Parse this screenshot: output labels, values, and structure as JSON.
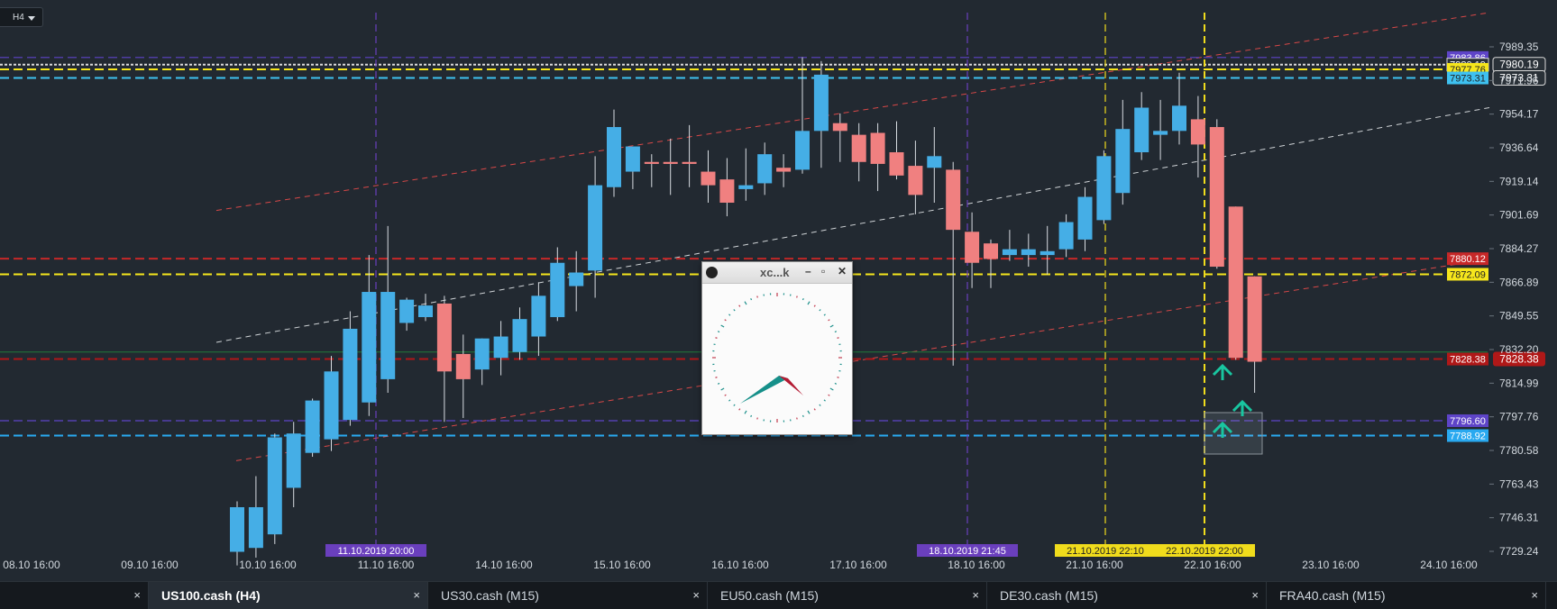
{
  "timeframe_select": {
    "value": "H4"
  },
  "chart_data": {
    "type": "candlestick",
    "symbol": "US100.cash",
    "timeframe": "H4",
    "ylim": [
      7722,
      7995
    ],
    "price_ticks": [
      "7989.35",
      "7971.96",
      "7954.17",
      "7936.64",
      "7919.14",
      "7901.69",
      "7884.27",
      "7866.89",
      "7849.55",
      "7832.20",
      "7814.99",
      "7797.76",
      "7780.58",
      "7763.43",
      "7746.31",
      "7729.24"
    ],
    "x_labels": [
      "08.10 16:00",
      "09.10 16:00",
      "10.10 16:00",
      "11.10 16:00",
      "14.10 16:00",
      "15.10 16:00",
      "16.10 16:00",
      "17.10 16:00",
      "18.10 16:00",
      "21.10 16:00",
      "22.10 16:00",
      "23.10 16:00",
      "24.10 16:00"
    ],
    "candles": [
      {
        "o": 7729,
        "h": 7755,
        "l": 7722,
        "c": 7752
      },
      {
        "o": 7731,
        "h": 7768,
        "l": 7726,
        "c": 7752
      },
      {
        "o": 7738,
        "h": 7790,
        "l": 7733,
        "c": 7788
      },
      {
        "o": 7762,
        "h": 7796,
        "l": 7752,
        "c": 7790
      },
      {
        "o": 7780,
        "h": 7808,
        "l": 7778,
        "c": 7807
      },
      {
        "o": 7787,
        "h": 7830,
        "l": 7781,
        "c": 7822
      },
      {
        "o": 7797,
        "h": 7853,
        "l": 7794,
        "c": 7844
      },
      {
        "o": 7806,
        "h": 7882,
        "l": 7799,
        "c": 7863
      },
      {
        "o": 7818,
        "h": 7897,
        "l": 7811,
        "c": 7863
      },
      {
        "o": 7847,
        "h": 7860,
        "l": 7843,
        "c": 7859
      },
      {
        "o": 7850,
        "h": 7862,
        "l": 7848,
        "c": 7856
      },
      {
        "o": 7857,
        "h": 7861,
        "l": 7796,
        "c": 7822
      },
      {
        "o": 7831,
        "h": 7841,
        "l": 7798,
        "c": 7818
      },
      {
        "o": 7823,
        "h": 7839,
        "l": 7815,
        "c": 7839
      },
      {
        "o": 7829,
        "h": 7848,
        "l": 7820,
        "c": 7840
      },
      {
        "o": 7832,
        "h": 7855,
        "l": 7828,
        "c": 7849
      },
      {
        "o": 7840,
        "h": 7868,
        "l": 7830,
        "c": 7861
      },
      {
        "o": 7850,
        "h": 7886,
        "l": 7848,
        "c": 7878
      },
      {
        "o": 7866,
        "h": 7884,
        "l": 7853,
        "c": 7873
      },
      {
        "o": 7874,
        "h": 7933,
        "l": 7860,
        "c": 7918
      },
      {
        "o": 7917,
        "h": 7957,
        "l": 7912,
        "c": 7948
      },
      {
        "o": 7925,
        "h": 7937,
        "l": 7916,
        "c": 7938
      },
      {
        "o": 7930,
        "h": 7934,
        "l": 7917,
        "c": 7929
      },
      {
        "o": 7930,
        "h": 7942,
        "l": 7913,
        "c": 7929
      },
      {
        "o": 7930,
        "h": 7949,
        "l": 7917,
        "c": 7929
      },
      {
        "o": 7925,
        "h": 7936,
        "l": 7909,
        "c": 7918
      },
      {
        "o": 7921,
        "h": 7932,
        "l": 7902,
        "c": 7909
      },
      {
        "o": 7916,
        "h": 7937,
        "l": 7910,
        "c": 7918
      },
      {
        "o": 7919,
        "h": 7940,
        "l": 7913,
        "c": 7934
      },
      {
        "o": 7927,
        "h": 7934,
        "l": 7917,
        "c": 7925
      },
      {
        "o": 7926,
        "h": 7984,
        "l": 7924,
        "c": 7946
      },
      {
        "o": 7946,
        "h": 7982,
        "l": 7927,
        "c": 7975
      },
      {
        "o": 7950,
        "h": 7955,
        "l": 7930,
        "c": 7946
      },
      {
        "o": 7944,
        "h": 7950,
        "l": 7920,
        "c": 7930
      },
      {
        "o": 7945,
        "h": 7950,
        "l": 7915,
        "c": 7929
      },
      {
        "o": 7935,
        "h": 7951,
        "l": 7921,
        "c": 7923
      },
      {
        "o": 7928,
        "h": 7941,
        "l": 7903,
        "c": 7913
      },
      {
        "o": 7927,
        "h": 7948,
        "l": 7909,
        "c": 7933
      },
      {
        "o": 7926,
        "h": 7930,
        "l": 7825,
        "c": 7895
      },
      {
        "o": 7894,
        "h": 7904,
        "l": 7865,
        "c": 7878
      },
      {
        "o": 7888,
        "h": 7890,
        "l": 7865,
        "c": 7880
      },
      {
        "o": 7882,
        "h": 7895,
        "l": 7879,
        "c": 7885
      },
      {
        "o": 7882,
        "h": 7893,
        "l": 7876,
        "c": 7885
      },
      {
        "o": 7882,
        "h": 7897,
        "l": 7872,
        "c": 7884
      },
      {
        "o": 7885,
        "h": 7903,
        "l": 7881,
        "c": 7899
      },
      {
        "o": 7890,
        "h": 7917,
        "l": 7884,
        "c": 7912
      },
      {
        "o": 7900,
        "h": 7936,
        "l": 7898,
        "c": 7933
      },
      {
        "o": 7914,
        "h": 7962,
        "l": 7908,
        "c": 7947
      },
      {
        "o": 7935,
        "h": 7966,
        "l": 7931,
        "c": 7958
      },
      {
        "o": 7944,
        "h": 7962,
        "l": 7931,
        "c": 7946
      },
      {
        "o": 7946,
        "h": 7976,
        "l": 7939,
        "c": 7959
      },
      {
        "o": 7952,
        "h": 7964,
        "l": 7922,
        "c": 7939
      },
      {
        "o": 7948,
        "h": 7952,
        "l": 7875,
        "c": 7876
      },
      {
        "o": 7907,
        "h": 7907,
        "l": 7828,
        "c": 7829
      },
      {
        "o": 7871,
        "h": 7871,
        "l": 7811,
        "c": 7827
      }
    ],
    "levels": [
      {
        "price": 7983.86,
        "color": "#5e44c8",
        "label_color": "#ffffff"
      },
      {
        "price": 7980.19,
        "color": "#2a3138",
        "label_color": "#ffffff"
      },
      {
        "price": 7977.76,
        "color": "#f6e61c",
        "label_color": "#222222"
      },
      {
        "price": 7973.31,
        "color": "#3ec1f0",
        "label_color": "#222222"
      },
      {
        "price": 7880.12,
        "color": "#c62828",
        "label_color": "#ffffff"
      },
      {
        "price": 7872.09,
        "color": "#f6e61c",
        "label_color": "#222222"
      },
      {
        "price": 7828.38,
        "color": "#b01818",
        "label_color": "#ffffff"
      },
      {
        "price": 7796.6,
        "color": "#5e44c8",
        "label_color": "#ffffff"
      },
      {
        "price": 7788.92,
        "color": "#29a9f0",
        "label_color": "#ffffff"
      }
    ],
    "time_markers": [
      {
        "label": "11.10.2019 20:00",
        "color": "#6a3fbd"
      },
      {
        "label": "18.10.2019 21:45",
        "color": "#6a3fbd"
      },
      {
        "label": "21.10.2019 22:10",
        "color": "#f0dc1c"
      },
      {
        "label": "22.10.2019 22:00",
        "color": "#f0dc1c"
      }
    ]
  },
  "clock_window": {
    "title": "xc...k"
  },
  "tabs": [
    {
      "label": "",
      "close": "×",
      "active": false
    },
    {
      "label": "US100.cash (H4)",
      "close": "×",
      "active": true
    },
    {
      "label": "US30.cash (M15)",
      "close": "×",
      "active": false
    },
    {
      "label": "EU50.cash (M15)",
      "close": "×",
      "active": false
    },
    {
      "label": "DE30.cash (M15)",
      "close": "×",
      "active": false
    },
    {
      "label": "FRA40.cash (M15)",
      "close": "×",
      "active": false
    }
  ]
}
